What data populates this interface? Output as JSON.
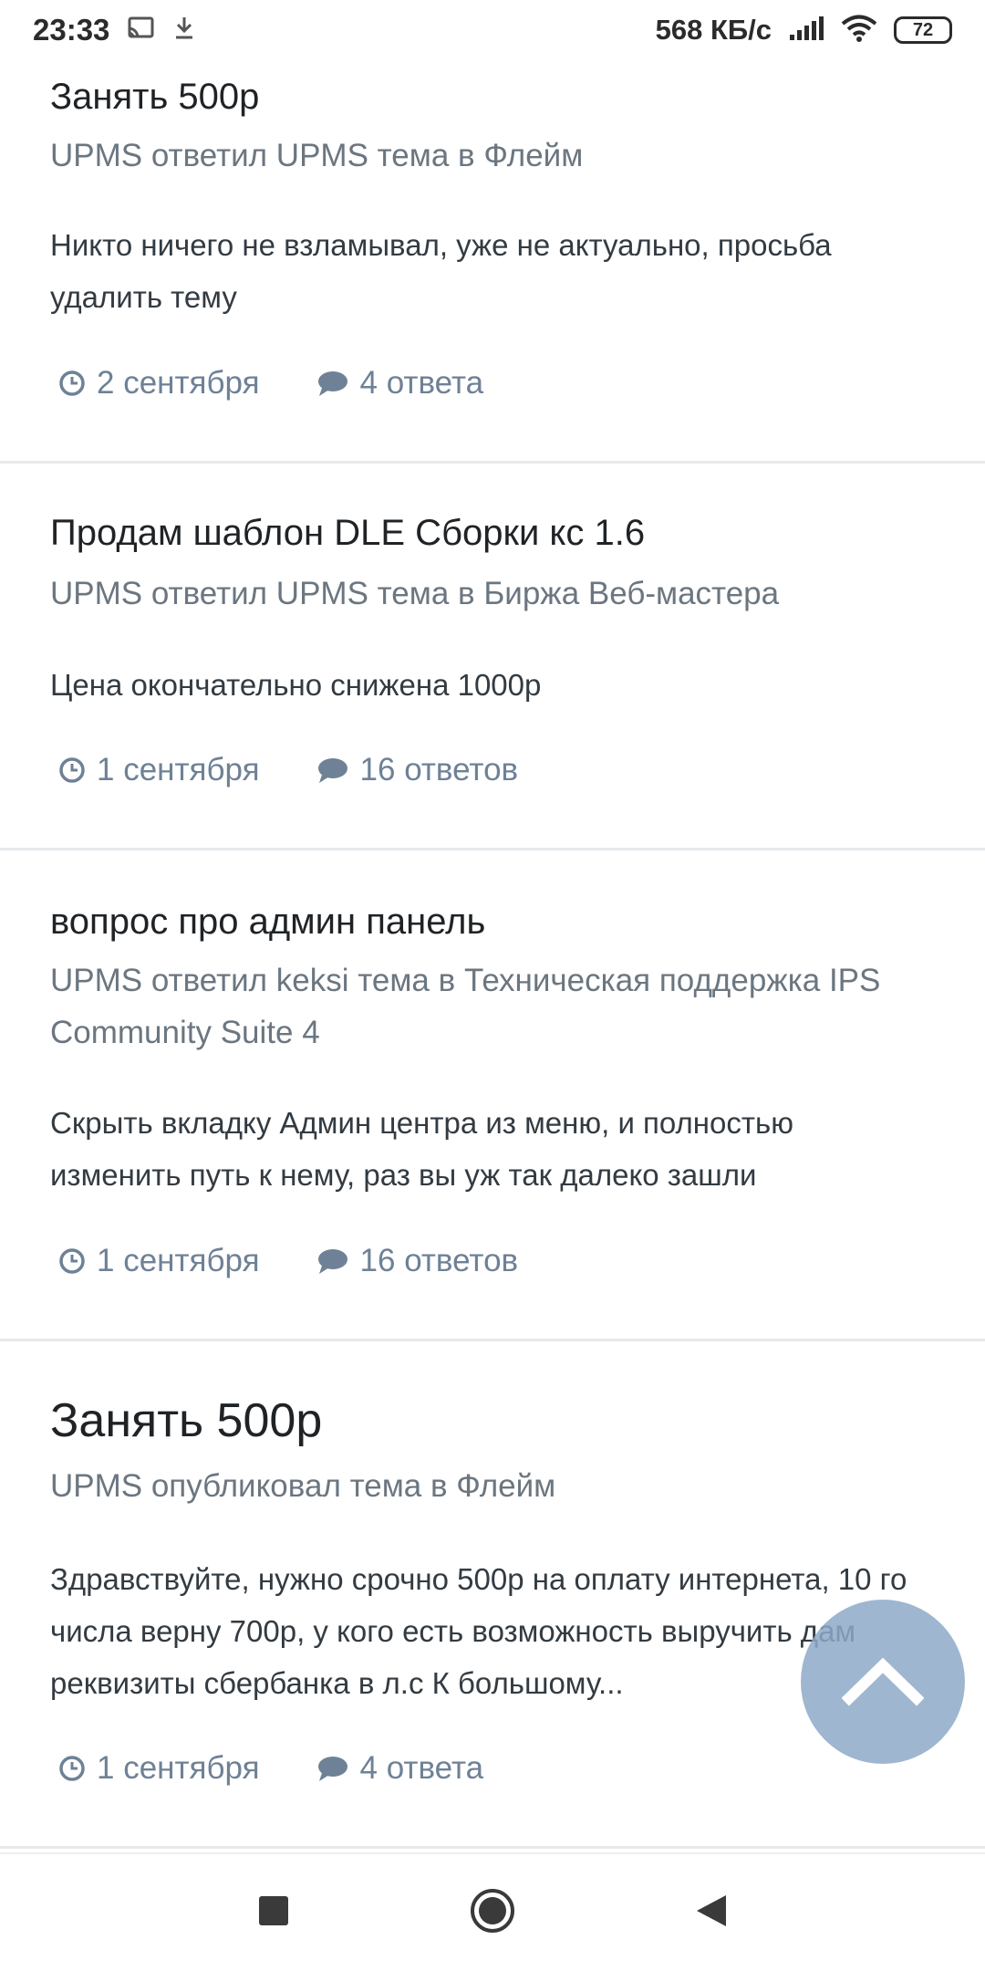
{
  "status_bar": {
    "time": "23:33",
    "speed": "568 КБ/с",
    "battery": "72",
    "icons": [
      "cast-icon",
      "download-icon",
      "signal-icon",
      "wifi-icon",
      "battery-icon"
    ]
  },
  "posts": [
    {
      "title": "Занять 500р",
      "meta": "UPMS ответил UPMS тема в Флейм",
      "excerpt": "Никто ничего не взламывал, уже не актуально, просьба удалить тему",
      "date": "2 сентября",
      "replies": "4 ответа"
    },
    {
      "title": "Продам шаблон DLE Сборки кс 1.6",
      "meta": "UPMS ответил UPMS тема в Биржа Веб-мастера",
      "excerpt": "Цена окончательно снижена 1000р",
      "date": "1 сентября",
      "replies": "16 ответов"
    },
    {
      "title": "вопрос про админ панель",
      "meta": "UPMS ответил keksi тема в Техническая поддержка IPS Community Suite 4",
      "excerpt": "Скрыть вкладку Админ центра из меню, и полностью изменить путь к нему, раз вы уж так далеко зашли",
      "date": "1 сентября",
      "replies": "16 ответов"
    },
    {
      "title": "Занять 500р",
      "meta": "UPMS опубликовал тема в Флейм",
      "excerpt": "Здравствуйте, нужно срочно 500р на оплату интернета, 10 го числа верну 700р, у кого есть возможность выручить дам реквизиты сбербанка в л.с К большому...",
      "date": "1 сентября",
      "replies": "4 ответа"
    }
  ],
  "colors": {
    "accent": "#8ea9c8",
    "stats": "#6e8196",
    "meta": "#6b7680",
    "divider": "#e7e9eb"
  },
  "nav_bar": {
    "icons": [
      "recent-apps-icon",
      "home-icon",
      "back-icon"
    ]
  }
}
